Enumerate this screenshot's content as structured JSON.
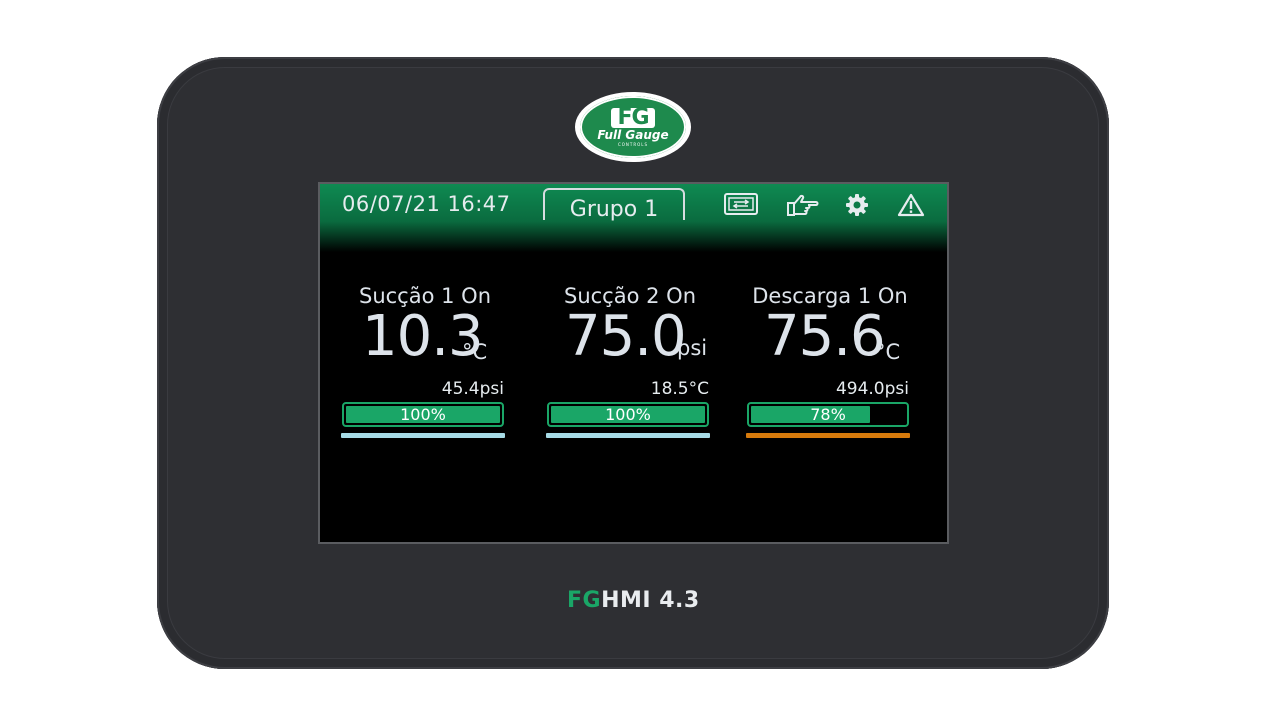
{
  "device": {
    "logo": {
      "mark": "FG",
      "text": "Full Gauge",
      "subtext": "CONTROLS"
    },
    "model_prefix": "FG",
    "model_name": "HMI 4.3",
    "colors": {
      "model_prefix": "#1aa667",
      "model_name": "#e9ecef"
    }
  },
  "header": {
    "datetime": "06/07/21 16:47",
    "group_tab": "Grupo 1",
    "icons": [
      "screen-switch-icon",
      "touch-hand-icon",
      "gear-icon",
      "warning-icon"
    ]
  },
  "panels": [
    {
      "label": "Sucção 1 On",
      "value": "10.3",
      "unit": "°C",
      "secondary": "45.4psi",
      "bar_percent": 100,
      "bar_label": "100%",
      "underline_color": "#a7dbe6"
    },
    {
      "label": "Sucção 2 On",
      "value": "75.0",
      "unit": "psi",
      "secondary": "18.5°C",
      "bar_percent": 100,
      "bar_label": "100%",
      "underline_color": "#a7dbe6"
    },
    {
      "label": "Descarga 1 On",
      "value": "75.6",
      "unit": "°C",
      "secondary": "494.0psi",
      "bar_percent": 78,
      "bar_label": "78%",
      "underline_color": "#d67a0c"
    }
  ]
}
